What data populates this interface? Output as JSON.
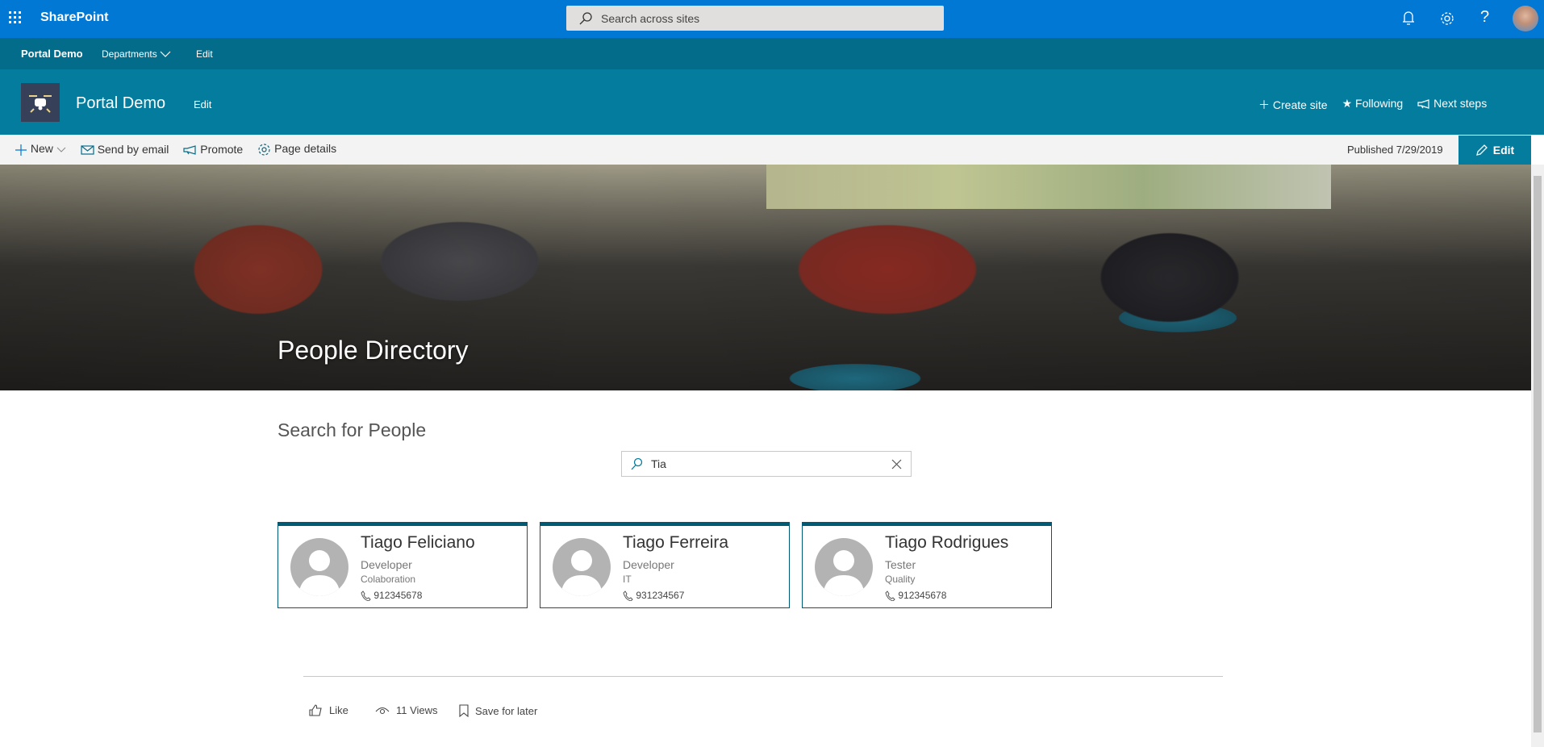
{
  "topbar": {
    "app_name": "SharePoint",
    "search_placeholder": "Search across sites",
    "icons": [
      "waffle-icon",
      "bell-icon",
      "gear-icon",
      "help-icon",
      "avatar"
    ]
  },
  "nav": {
    "site": "Portal Demo",
    "items": [
      {
        "label": "Departments"
      },
      {
        "label": "Edit"
      }
    ]
  },
  "site_header": {
    "title": "Portal Demo",
    "edit": "Edit",
    "actions": [
      {
        "label": "Create site",
        "icon": "plus-icon"
      },
      {
        "label": "Following",
        "icon": "star-icon"
      },
      {
        "label": "Next steps",
        "icon": "megaphone-icon"
      }
    ]
  },
  "command_bar": {
    "items": [
      {
        "label": "New",
        "icon": "plus-icon"
      },
      {
        "label": "Send by email",
        "icon": "mail-icon"
      },
      {
        "label": "Promote",
        "icon": "megaphone-icon"
      },
      {
        "label": "Page details",
        "icon": "gear-icon"
      }
    ],
    "published": "Published 7/29/2019",
    "edit": "Edit"
  },
  "hero": {
    "title": "People Directory"
  },
  "people_search": {
    "title": "Search for People",
    "value": "Tia"
  },
  "people": [
    {
      "name": "Tiago Feliciano",
      "role": "Developer",
      "department": "Colaboration",
      "phone": "912345678"
    },
    {
      "name": "Tiago Ferreira",
      "role": "Developer",
      "department": "IT",
      "phone": "931234567"
    },
    {
      "name": "Tiago Rodrigues",
      "role": "Tester",
      "department": "Quality",
      "phone": "912345678"
    }
  ],
  "footer": {
    "like": "Like",
    "views": "11 Views",
    "save": "Save for later"
  },
  "colors": {
    "suite_bar": "#0078d4",
    "nav": "#036c8a",
    "header": "#037c9e",
    "card_accent": "#005a73"
  }
}
